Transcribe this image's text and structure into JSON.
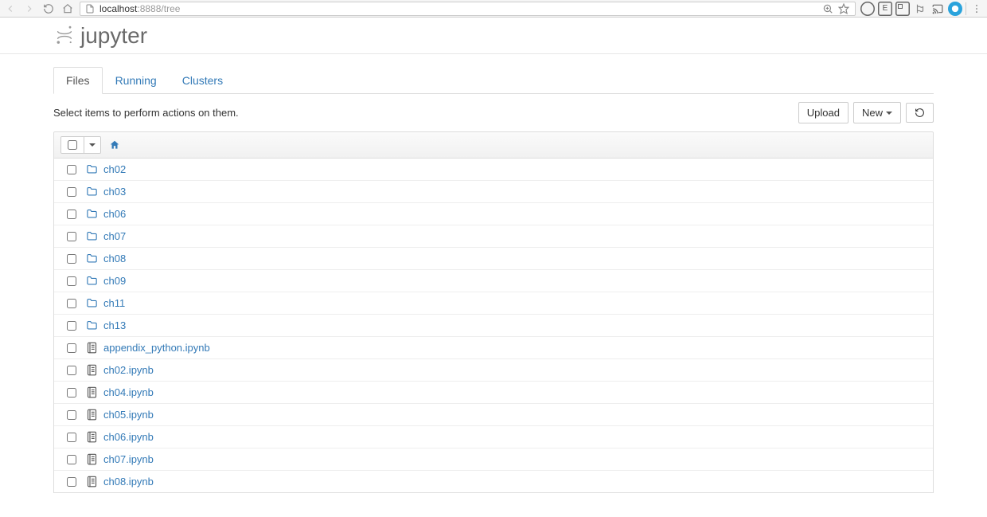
{
  "browser": {
    "url_host": "localhost",
    "url_port_path": ":8888/tree"
  },
  "logo_text": "jupyter",
  "tabs": [
    {
      "label": "Files",
      "active": true
    },
    {
      "label": "Running",
      "active": false
    },
    {
      "label": "Clusters",
      "active": false
    }
  ],
  "toolbar": {
    "hint": "Select items to perform actions on them.",
    "upload_label": "Upload",
    "new_label": "New"
  },
  "items": [
    {
      "type": "dir",
      "name": "ch02"
    },
    {
      "type": "dir",
      "name": "ch03"
    },
    {
      "type": "dir",
      "name": "ch06"
    },
    {
      "type": "dir",
      "name": "ch07"
    },
    {
      "type": "dir",
      "name": "ch08"
    },
    {
      "type": "dir",
      "name": "ch09"
    },
    {
      "type": "dir",
      "name": "ch11"
    },
    {
      "type": "dir",
      "name": "ch13"
    },
    {
      "type": "nb",
      "name": "appendix_python.ipynb"
    },
    {
      "type": "nb",
      "name": "ch02.ipynb"
    },
    {
      "type": "nb",
      "name": "ch04.ipynb"
    },
    {
      "type": "nb",
      "name": "ch05.ipynb"
    },
    {
      "type": "nb",
      "name": "ch06.ipynb"
    },
    {
      "type": "nb",
      "name": "ch07.ipynb"
    },
    {
      "type": "nb",
      "name": "ch08.ipynb"
    }
  ]
}
